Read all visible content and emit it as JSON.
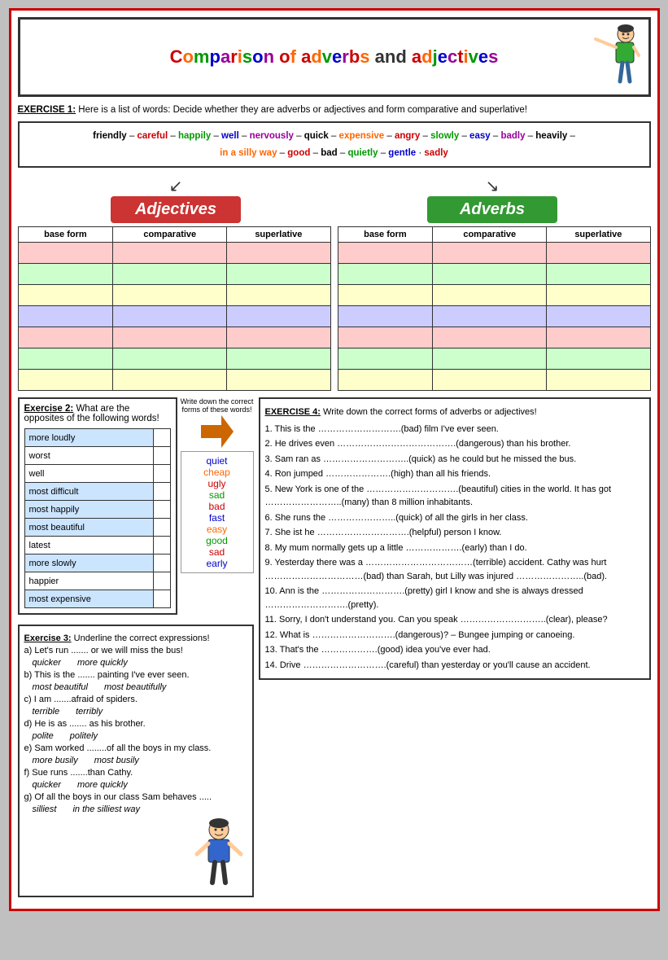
{
  "title": "Comparison of adverbs and adjectives",
  "exercise1": {
    "label": "EXERCISE 1:",
    "text": "Here is a list of words: Decide whether they are adverbs or adjectives  and form comparative and superlative!"
  },
  "wordList": {
    "line1": [
      "friendly",
      "careful",
      "happily",
      "well",
      "nervously",
      "quick",
      "expensive",
      "angry",
      "slowly",
      "easy",
      "badly",
      "heavily"
    ],
    "line2": [
      "in a silly way",
      "good",
      "bad",
      "quietly",
      "gentle",
      "sadly"
    ]
  },
  "adjectives_label": "Adjectives",
  "adverbs_label": "Adverbs",
  "tableHeaders": {
    "base": "base form",
    "comparative": "comparative",
    "superlative": "superlative"
  },
  "exercise2": {
    "label": "Exercise 2:",
    "text": "What are the opposites of the following words!",
    "words": [
      "more loudly",
      "worst",
      "well",
      "most difficult",
      "most happily",
      "most beautiful",
      "latest",
      "more slowly",
      "happier",
      "most expensive"
    ]
  },
  "middleBox": {
    "instruction": "Write down the correct forms of these words!",
    "words": [
      "quiet",
      "cheap",
      "ugly",
      "sad",
      "bad",
      "fast",
      "easy",
      "good",
      "sad",
      "early"
    ]
  },
  "exercise3": {
    "label": "Exercise 3:",
    "title": "Underline the correct expressions!",
    "items": [
      {
        "text": "a) Let's run ....... or we will miss the bus!",
        "choices": [
          "quicker",
          "more quickly"
        ]
      },
      {
        "text": "b) This is the ....... painting I've ever seen.",
        "choices": [
          "most beautiful",
          "most beautifully"
        ]
      },
      {
        "text": "c) I am .......afraid of spiders.",
        "choices": [
          "terrible",
          "terribly"
        ]
      },
      {
        "text": "d) He is as ....... as  his brother.",
        "choices": [
          "polite",
          "politely"
        ]
      },
      {
        "text": "e) Sam worked ........of all the boys in my class.",
        "choices": [
          "more busily",
          "most busily"
        ]
      },
      {
        "text": "f) Sue runs .......than Cathy.",
        "choices": [
          "quicker",
          "more quickly"
        ]
      },
      {
        "text": "g) Of all the boys in our class Sam behaves .....",
        "choices": [
          "silliest",
          "in the silliest way"
        ]
      }
    ]
  },
  "exercise4": {
    "label": "EXERCISE 4:",
    "title": "Write down the correct forms of adverbs or adjectives!",
    "items": [
      "1. This is the ……………………….(bad) film I've ever seen.",
      "2. He drives even ………………………………….(dangerous) than his brother.",
      "3. Sam ran as ………………………..(quick) as he could but he missed the bus.",
      "4. Ron jumped ………………….(high) than all his friends.",
      "5. New York is one of the ………………………….(beautiful) cities in the world. It has got  ……………………..(many) than 8 million inhabitants.",
      "6. She runs the …………………..(quick) of all the girls in her class.",
      "7. She ist he ………………………….(helpful) person I know.",
      "8. My mum normally gets up a little ……………….(early) than I do.",
      "9. Yesterday there was a ………………………………(terrible) accident. Cathy was hurt ……………………………(bad) than Sarah, but Lilly was injured …………………..(bad).",
      "10. Ann is the ……………………….(pretty) girl I know and she is always dressed ……………………….(pretty).",
      "11. Sorry, I don't understand you. Can you speak ………………………..(clear), please?",
      "12. What is ……………………….(dangerous)? – Bungee jumping or canoeing.",
      "13. That's the ……………….(good) idea you've ever had.",
      "14. Drive ……………………….(careful) than yesterday or you'll cause an accident."
    ]
  }
}
